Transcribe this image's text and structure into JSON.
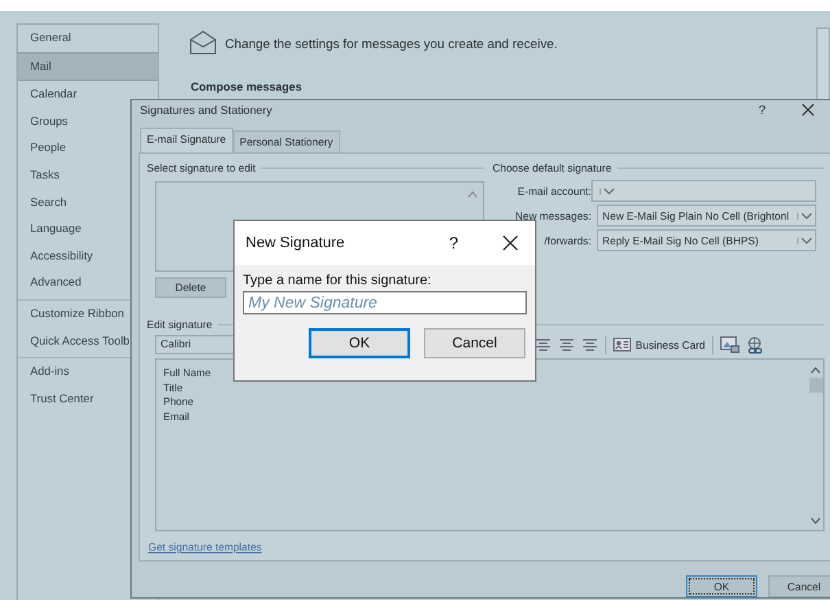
{
  "options": {
    "sidebar_groups": [
      {
        "items": [
          {
            "label": "General",
            "selected": false
          },
          {
            "label": "Mail",
            "selected": true
          },
          {
            "label": "Calendar",
            "selected": false
          },
          {
            "label": "Groups",
            "selected": false
          },
          {
            "label": "People",
            "selected": false
          },
          {
            "label": "Tasks",
            "selected": false
          },
          {
            "label": "Search",
            "selected": false
          },
          {
            "label": "Language",
            "selected": false
          },
          {
            "label": "Accessibility",
            "selected": false
          },
          {
            "label": "Advanced",
            "selected": false
          }
        ]
      },
      {
        "items": [
          {
            "label": "Customize Ribbon",
            "selected": false
          },
          {
            "label": "Quick Access Toolb",
            "selected": false
          }
        ]
      },
      {
        "items": [
          {
            "label": "Add-ins",
            "selected": false
          },
          {
            "label": "Trust Center",
            "selected": false
          }
        ]
      }
    ],
    "header": "Change the settings for messages you create and receive.",
    "section": "Compose messages"
  },
  "signatures_dialog": {
    "title": "Signatures and Stationery",
    "help": "?",
    "tabs": [
      {
        "label": "E-mail Signature",
        "selected": true
      },
      {
        "label": "Personal Stationery",
        "selected": false
      }
    ],
    "select_label": "Select signature to edit",
    "delete_button": "Delete",
    "default_label": "Choose default signature",
    "fields": [
      {
        "label": "E-mail account:"
      },
      {
        "label": "New messages:",
        "value": "New E-Mail Sig Plain No Cell (Brightonl"
      },
      {
        "label": "/forwards:",
        "value": "Reply E-Mail Sig No Cell (BHPS)"
      }
    ],
    "edit_label": "Edit signature",
    "font": "Calibri",
    "business_card": "Business Card",
    "body_lines": [
      "Full Name",
      "Title",
      "Phone",
      "Email"
    ],
    "templates_link": "Get signature templates",
    "buttons": [
      "OK",
      "Cancel"
    ]
  },
  "new_signature": {
    "title": "New Signature",
    "help": "?",
    "prompt": "Type a name for this signature:",
    "placeholder": "My New Signature",
    "buttons": [
      "OK",
      "Cancel"
    ]
  }
}
